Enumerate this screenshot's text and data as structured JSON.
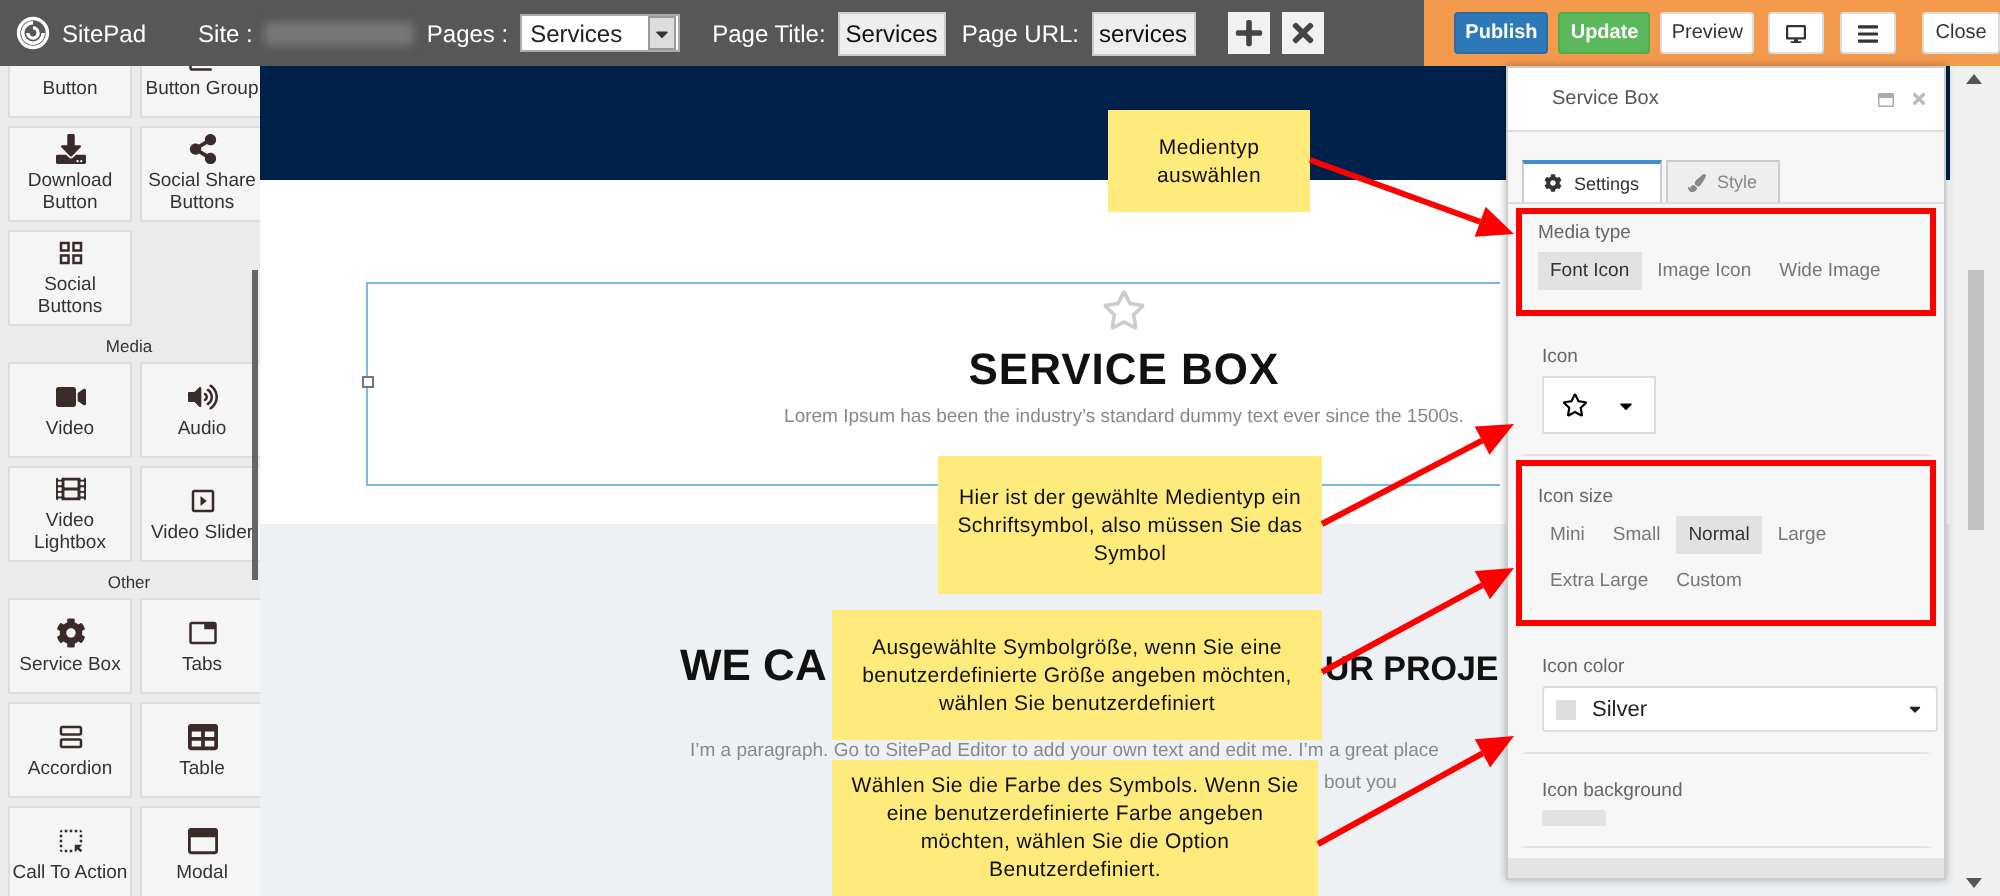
{
  "toolbar": {
    "logo_text": "SitePad",
    "site_label": "Site :",
    "pages_label": "Pages :",
    "pages_value": "Services",
    "page_title_label": "Page Title:",
    "page_title_value": "Services",
    "page_url_label": "Page URL:",
    "page_url_value": "services",
    "actions": [
      {
        "kind": "primary",
        "label": "Publish"
      },
      {
        "kind": "success",
        "label": "Update"
      },
      {
        "kind": "plain",
        "label": "Preview"
      },
      {
        "kind": "desktop"
      },
      {
        "kind": "menu"
      },
      {
        "kind": "plain",
        "label": "Close"
      }
    ]
  },
  "sidebar": {
    "groups": [
      {
        "widgets": [
          "Button",
          "Button Group",
          "Download Button",
          "Social Share Buttons",
          "Social Buttons"
        ]
      },
      {
        "heading": "Media",
        "widgets": [
          "Video",
          "Audio",
          "Video Lightbox",
          "Video Slider"
        ]
      },
      {
        "heading": "Other",
        "widgets": [
          "Service Box",
          "Tabs",
          "Accordion",
          "Table",
          "Call To Action",
          "Modal"
        ]
      }
    ]
  },
  "canvas": {
    "service_box": {
      "title": "SERVICE BOX",
      "text": "Lorem Ipsum has been the industry’s standard dummy text ever since the 1500s."
    },
    "section": {
      "heading_parts": [
        "WE CA",
        "UR PROJE"
      ],
      "paragraph_lines": [
        "I’m a paragraph. Go to SitePad Editor to add your own text and edit me. I’m a great place",
        "bout you"
      ]
    }
  },
  "panel": {
    "title": "Service Box",
    "tabs": [
      {
        "label": "Settings",
        "selected": true
      },
      {
        "label": "Style",
        "selected": false
      }
    ],
    "fields": [
      {
        "kind": "options",
        "label": "Media type",
        "highlighted": true,
        "options": [
          {
            "label": "Font Icon",
            "selected": true
          },
          {
            "label": "Image Icon",
            "selected": false
          },
          {
            "label": "Wide Image",
            "selected": false
          }
        ]
      },
      {
        "kind": "icon_picker",
        "label": "Icon",
        "highlighted": false
      },
      {
        "kind": "options",
        "label": "Icon size",
        "highlighted": true,
        "options": [
          {
            "label": "Mini",
            "selected": false
          },
          {
            "label": "Small",
            "selected": false
          },
          {
            "label": "Normal",
            "selected": true
          },
          {
            "label": "Large",
            "selected": false
          },
          {
            "label": "Extra Large",
            "selected": false
          },
          {
            "label": "Custom",
            "selected": false
          }
        ]
      },
      {
        "kind": "color_select",
        "label": "Icon color",
        "highlighted": false,
        "value": "Silver"
      },
      {
        "kind": "swatch",
        "label": "Icon background",
        "highlighted": false
      }
    ]
  },
  "callouts": [
    {
      "text": "Medientyp auswählen"
    },
    {
      "text": "Hier ist der gewählte Medientyp ein Schriftsymbol, also müssen Sie das Symbol"
    },
    {
      "text": "Ausgewählte Symbolgröße, wenn Sie eine benutzerdefinierte Größe angeben möchten, wählen Sie benutzerdefiniert"
    },
    {
      "text": "Wählen Sie die Farbe des Symbols. Wenn Sie eine benutzerdefinierte Farbe angeben möchten, wählen Sie die Option Benutzerdefiniert."
    }
  ]
}
